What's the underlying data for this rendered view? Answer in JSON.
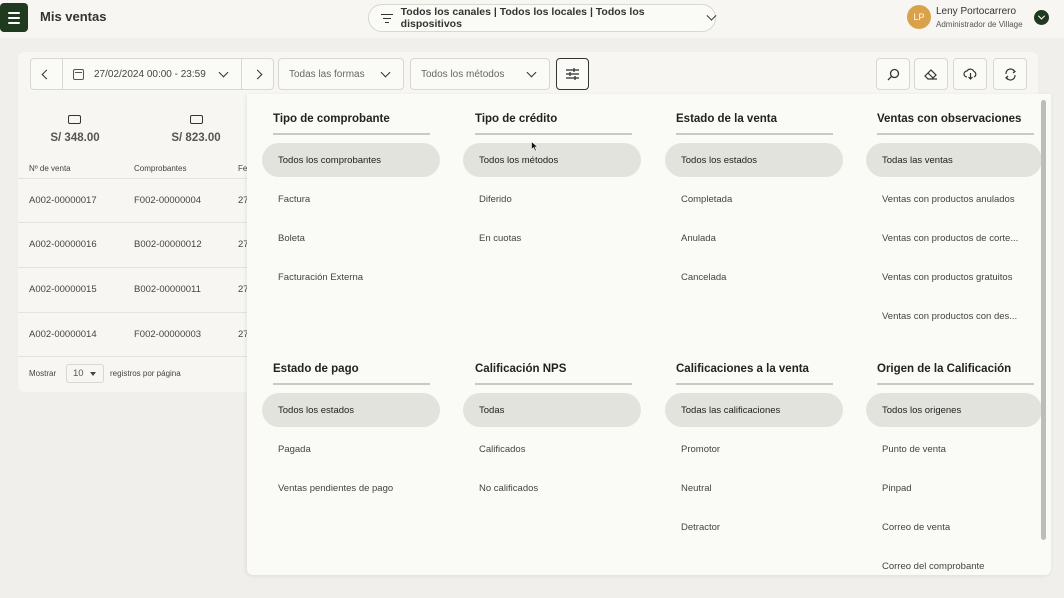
{
  "header": {
    "title": "Mis ventas",
    "channel_filter": "Todos los canales | Todos los locales | Todos los dispositivos",
    "user": {
      "initials": "LP",
      "name": "Leny Portocarrero",
      "role": "Administrador de Village"
    }
  },
  "toolbar": {
    "date_range": "27/02/2024 00:00 - 23:59",
    "form_select": "Todas las formas",
    "method_select": "Todos los métodos"
  },
  "summary": [
    {
      "icon": "cash-icon",
      "value": "S/ 348.00"
    },
    {
      "icon": "card-icon",
      "value": "S/ 823.00"
    }
  ],
  "table": {
    "headers": [
      "Nº de venta",
      "Comprobantes",
      "Fe"
    ],
    "rows": [
      {
        "sale": "A002-00000017",
        "receipt": "F002-00000004",
        "date": "27"
      },
      {
        "sale": "A002-00000016",
        "receipt": "B002-00000012",
        "date": "27"
      },
      {
        "sale": "A002-00000015",
        "receipt": "B002-00000011",
        "date": "27"
      },
      {
        "sale": "A002-00000014",
        "receipt": "F002-00000003",
        "date": "27"
      }
    ],
    "footer": {
      "show_label": "Mostrar",
      "page_size": "10",
      "per_page_label": "registros por página"
    }
  },
  "filters": {
    "tipo_comprobante": {
      "title": "Tipo de comprobante",
      "options": [
        "Todos los comprobantes",
        "Factura",
        "Boleta",
        "Facturación Externa"
      ]
    },
    "tipo_credito": {
      "title": "Tipo de crédito",
      "options": [
        "Todos los métodos",
        "Diferido",
        "En cuotas"
      ]
    },
    "estado_venta": {
      "title": "Estado de la venta",
      "options": [
        "Todos los estados",
        "Completada",
        "Anulada",
        "Cancelada"
      ]
    },
    "observaciones": {
      "title": "Ventas con observaciones",
      "options": [
        "Todas las ventas",
        "Ventas con productos anulados",
        "Ventas con productos de corte...",
        "Ventas con productos gratuitos",
        "Ventas con productos con des..."
      ]
    },
    "estado_pago": {
      "title": "Estado de pago",
      "options": [
        "Todos los estados",
        "Pagada",
        "Ventas pendientes de pago"
      ]
    },
    "nps": {
      "title": "Calificación NPS",
      "options": [
        "Todas",
        "Calificados",
        "No calificados"
      ]
    },
    "calificaciones": {
      "title": "Calificaciones a la venta",
      "options": [
        "Todas las calificaciones",
        "Promotor",
        "Neutral",
        "Detractor"
      ]
    },
    "origen": {
      "title": "Origen de la Calificación",
      "options": [
        "Todos los origenes",
        "Punto de venta",
        "Pinpad",
        "Correo de venta",
        "Correo del comprobante"
      ]
    }
  }
}
